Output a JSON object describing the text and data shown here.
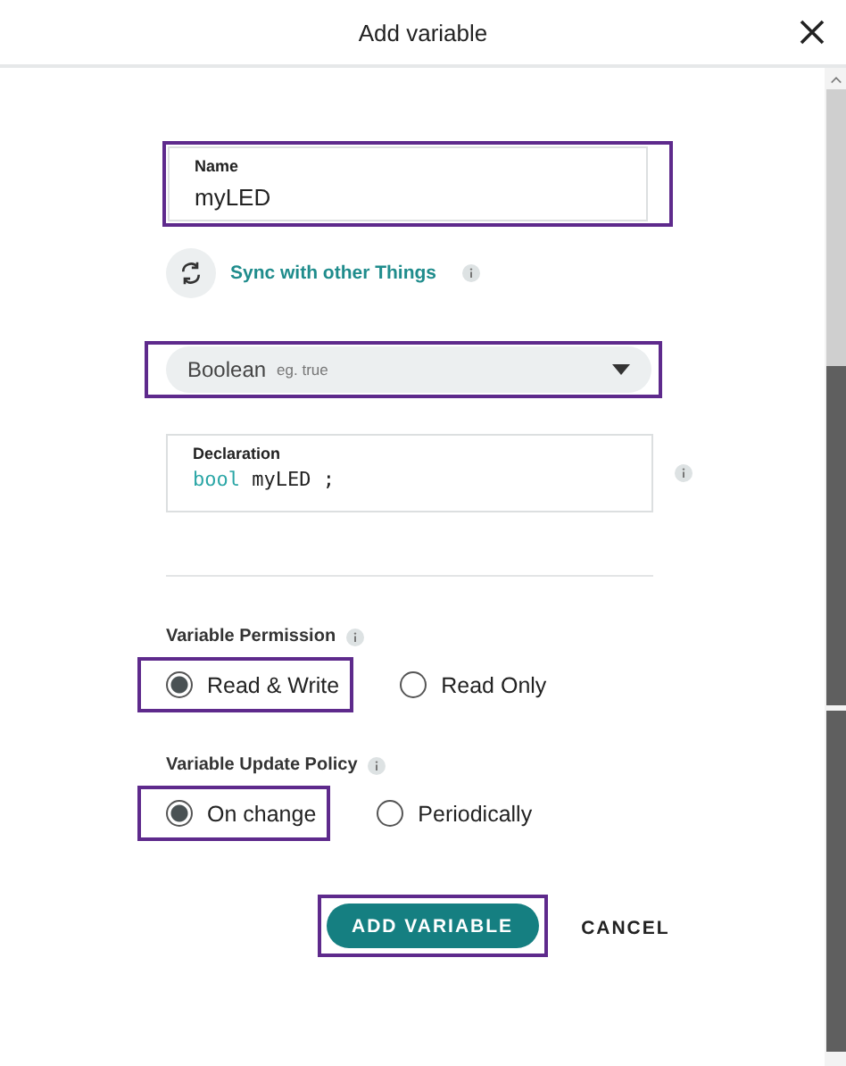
{
  "window": {
    "title": "Add variable"
  },
  "name_field": {
    "label": "Name",
    "value": "myLED",
    "highlighted": true
  },
  "sync": {
    "label": "Sync with other Things"
  },
  "type_select": {
    "value": "Boolean",
    "hint": "eg. true",
    "highlighted": true
  },
  "declaration": {
    "label": "Declaration",
    "keyword": "bool",
    "identifier": "myLED",
    "terminator": ";"
  },
  "permission": {
    "label": "Variable Permission",
    "options": [
      {
        "label": "Read & Write",
        "selected": true,
        "highlighted": true
      },
      {
        "label": "Read Only",
        "selected": false,
        "highlighted": false
      }
    ]
  },
  "update_policy": {
    "label": "Variable Update Policy",
    "options": [
      {
        "label": "On change",
        "selected": true,
        "highlighted": true
      },
      {
        "label": "Periodically",
        "selected": false,
        "highlighted": false
      }
    ]
  },
  "buttons": [
    {
      "label": "ADD VARIABLE",
      "kind": "primary",
      "highlighted": true
    },
    {
      "label": "CANCEL",
      "kind": "text",
      "highlighted": false
    }
  ]
}
